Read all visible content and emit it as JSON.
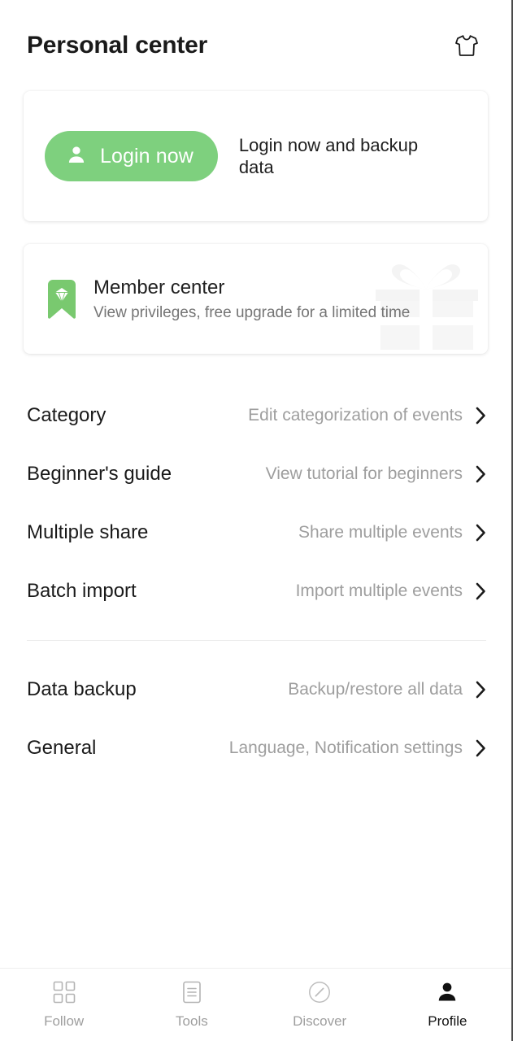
{
  "header": {
    "title": "Personal center",
    "theme_icon": "tshirt-icon"
  },
  "login_card": {
    "button_label": "Login now",
    "button_icon": "person-icon",
    "description": "Login now and backup data",
    "accent_color": "#7ed07e"
  },
  "member_card": {
    "title": "Member center",
    "subtitle": "View privileges, free upgrade for a limited time",
    "badge_icon": "diamond-badge-icon",
    "watermark_icon": "gift-icon",
    "badge_color": "#7ed07e"
  },
  "menu": {
    "group_one": [
      {
        "label": "Category",
        "value": "Edit categorization of events",
        "chevron": "chevron-right-icon"
      },
      {
        "label": "Beginner's guide",
        "value": "View tutorial for beginners",
        "chevron": "chevron-right-icon"
      },
      {
        "label": "Multiple share",
        "value": "Share multiple events",
        "chevron": "chevron-right-icon"
      },
      {
        "label": "Batch import",
        "value": "Import multiple events",
        "chevron": "chevron-right-icon"
      }
    ],
    "group_two": [
      {
        "label": "Data backup",
        "value": "Backup/restore all data",
        "chevron": "chevron-right-icon"
      },
      {
        "label": "General",
        "value": "Language, Notification settings",
        "chevron": "chevron-right-icon"
      }
    ]
  },
  "bottom_nav": {
    "items": [
      {
        "label": "Follow",
        "icon": "grid-icon",
        "active": false
      },
      {
        "label": "Tools",
        "icon": "document-lines-icon",
        "active": false
      },
      {
        "label": "Discover",
        "icon": "compass-icon",
        "active": false
      },
      {
        "label": "Profile",
        "icon": "person-filled-icon",
        "active": true
      }
    ]
  }
}
